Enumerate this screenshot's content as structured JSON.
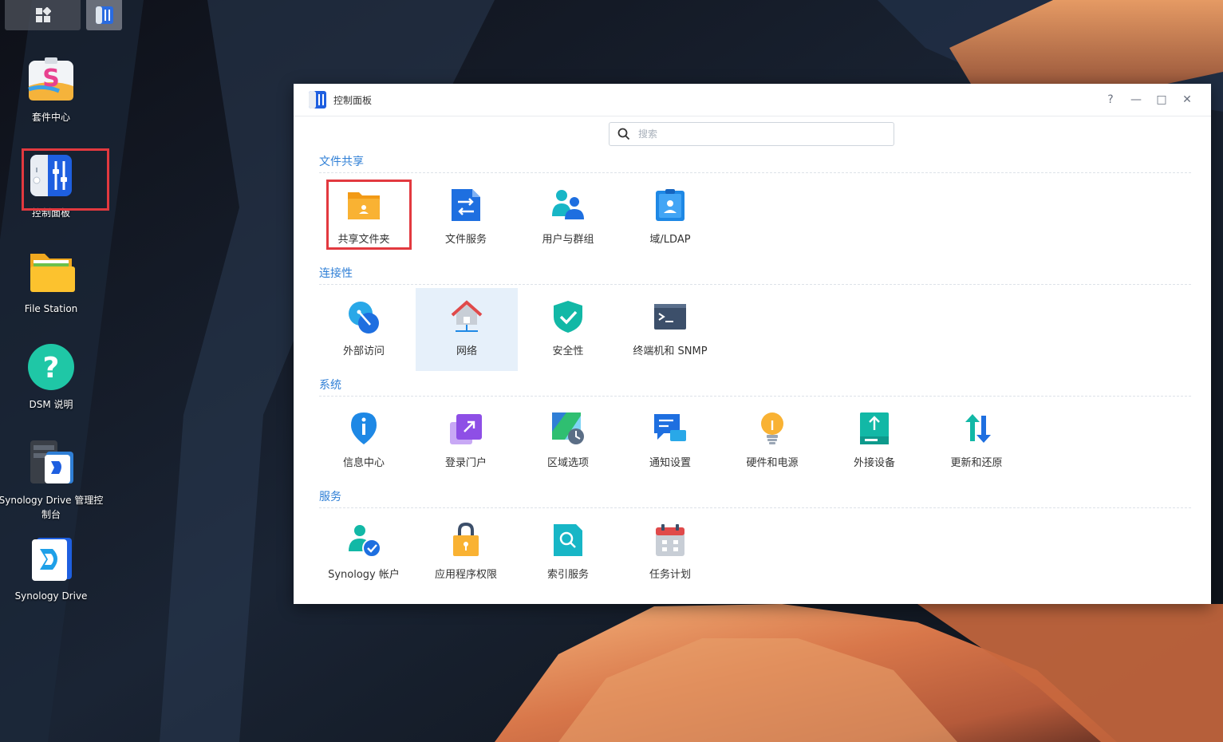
{
  "taskbar": {
    "main_menu_icon": "grid-icon",
    "active_app_icon": "control-panel-icon"
  },
  "desktop": {
    "icons": [
      {
        "label": "套件中心",
        "icon": "package-center-icon"
      },
      {
        "label": "控制面板",
        "icon": "control-panel-icon"
      },
      {
        "label": "File Station",
        "icon": "folder-icon"
      },
      {
        "label": "DSM 说明",
        "icon": "help-icon"
      },
      {
        "label": "Synology Drive 管理控制台",
        "icon": "drive-admin-icon"
      },
      {
        "label": "Synology Drive",
        "icon": "drive-icon"
      }
    ]
  },
  "window": {
    "title": "控制面板",
    "buttons": {
      "help": "?",
      "minimize": "—",
      "maximize": "□",
      "close": "✕"
    },
    "search": {
      "placeholder": "搜索",
      "value": ""
    },
    "sections": [
      {
        "title": "文件共享",
        "items": [
          {
            "label": "共享文件夹",
            "icon": "shared-folder-icon"
          },
          {
            "label": "文件服务",
            "icon": "file-services-icon"
          },
          {
            "label": "用户与群组",
            "icon": "user-group-icon"
          },
          {
            "label": "域/LDAP",
            "icon": "domain-ldap-icon"
          }
        ]
      },
      {
        "title": "连接性",
        "items": [
          {
            "label": "外部访问",
            "icon": "external-access-icon"
          },
          {
            "label": "网络",
            "icon": "network-icon"
          },
          {
            "label": "安全性",
            "icon": "security-icon"
          },
          {
            "label": "终端机和 SNMP",
            "icon": "terminal-icon"
          }
        ]
      },
      {
        "title": "系统",
        "items": [
          {
            "label": "信息中心",
            "icon": "info-center-icon"
          },
          {
            "label": "登录门户",
            "icon": "login-portal-icon"
          },
          {
            "label": "区域选项",
            "icon": "regional-options-icon"
          },
          {
            "label": "通知设置",
            "icon": "notification-icon"
          },
          {
            "label": "硬件和电源",
            "icon": "hardware-power-icon"
          },
          {
            "label": "外接设备",
            "icon": "external-devices-icon"
          },
          {
            "label": "更新和还原",
            "icon": "update-restore-icon"
          }
        ]
      },
      {
        "title": "服务",
        "items": [
          {
            "label": "Synology 帐户",
            "icon": "synology-account-icon"
          },
          {
            "label": "应用程序权限",
            "icon": "app-privileges-icon"
          },
          {
            "label": "索引服务",
            "icon": "indexing-service-icon"
          },
          {
            "label": "任务计划",
            "icon": "task-scheduler-icon"
          }
        ]
      }
    ],
    "selected_item": "网络",
    "highlighted_item": "共享文件夹"
  },
  "colors": {
    "accent": "#2f7fd6",
    "highlight_box": "#e2393f",
    "selected_bg": "#e6f0fa"
  }
}
